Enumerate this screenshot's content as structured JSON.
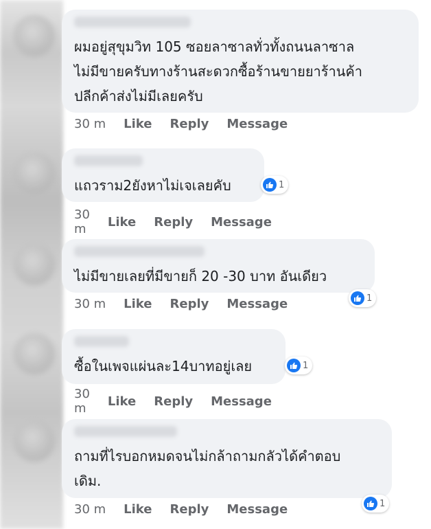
{
  "comments": [
    {
      "text": "ผมอยู่สุขุมวิท 105 ซอยลาซาลทั่วทั้งถนนลาซาล\nไม่มีขายครับทางร้านสะดวกซื้อร้านขายยาร้านค้า\nปลีกค้าส่งไม่มีเลยครับ",
      "time": "30 m",
      "likes": ""
    },
    {
      "text": "แถวราม2ยังหาไม่เจเลยคับ",
      "time": "30 m",
      "likes": "1"
    },
    {
      "text": "ไม่มีขายเลยที่มีขายก็ 20 -30 บาท อันเดียว",
      "time": "30 m",
      "likes": "1"
    },
    {
      "text": "ซื้อในเพจแผ่นละ14บาทอยู่เลย",
      "time": "30 m",
      "likes": "1"
    },
    {
      "text": "ถามที่ไรบอกหมดจนไม่กล้าถามกลัวได้คำตอบ\nเดิม.",
      "time": "30 m",
      "likes": "1"
    }
  ],
  "actions": {
    "like": "Like",
    "reply": "Reply",
    "message": "Message"
  },
  "icons": {
    "reaction": "like-thumb-icon"
  },
  "colors": {
    "accent": "#1877f2",
    "bubble": "#f0f2f5",
    "meta": "#65676b"
  }
}
